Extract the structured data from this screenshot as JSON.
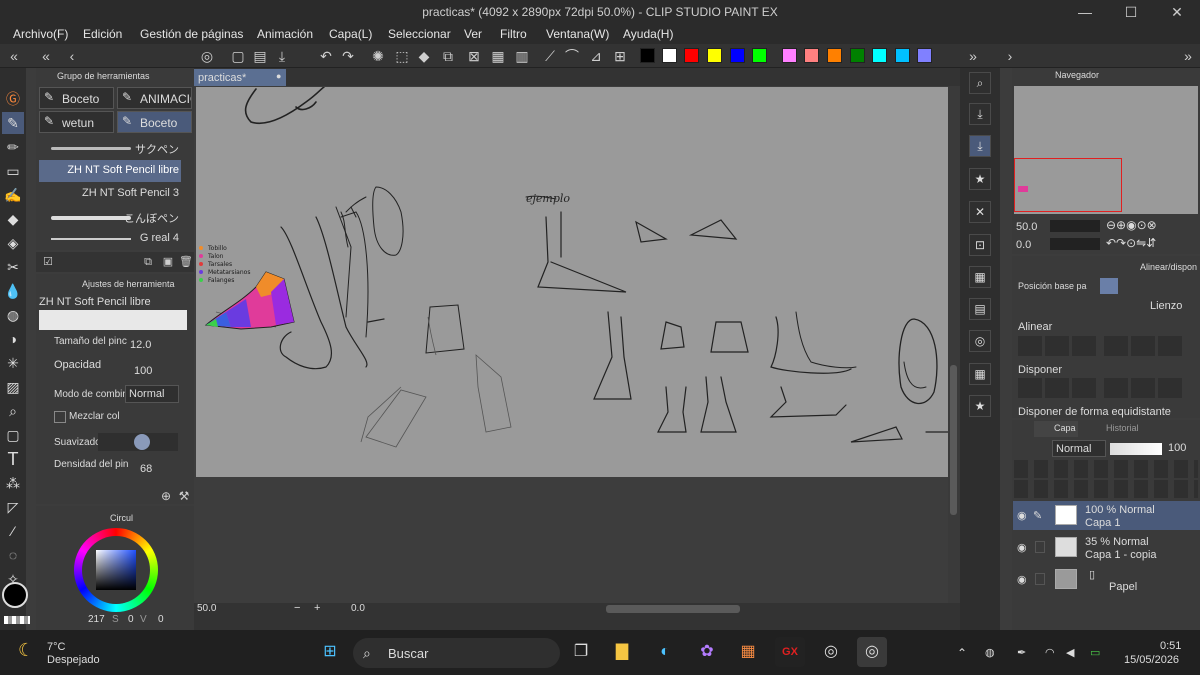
{
  "window": {
    "title": "practicas* (4092 x 2890px 72dpi 50.0%) - CLIP STUDIO PAINT EX",
    "min": "—",
    "max": "☐",
    "close": "✕"
  },
  "menu": [
    "Archivo(F)",
    "Edición",
    "Gestión de páginas",
    "Animación",
    "Capa(L)",
    "Seleccionar",
    "Ver",
    "Filtro",
    "Ventana(W)",
    "Ayuda(H)"
  ],
  "palette": [
    "#000000",
    "#ffffff",
    "#ff0000",
    "#ffff00",
    "#0000ff",
    "#00ff00",
    "#ff80ff",
    "#ff8080",
    "#ff8000",
    "#008000",
    "#00ffff",
    "#00c0ff",
    "#8080ff"
  ],
  "doc_tab": "practicas*",
  "subtool_panel": {
    "title": "Grupo de herramientas",
    "groups": [
      "Boceto",
      "ANIMACIO",
      "wetun",
      "Boceto"
    ],
    "brushes": [
      "サクペン",
      "ZH NT Soft Pencil libre",
      "ZH NT Soft Pencil 3",
      "こんぼペン",
      "G real 4"
    ]
  },
  "tool_property": {
    "title": "Ajustes de herramienta",
    "brush_name": "ZH NT Soft Pencil libre",
    "rows": {
      "size_label": "Tamaño del pinc",
      "size_value": "12.0",
      "opacity_label": "Opacidad",
      "opacity_value": "100",
      "blend_label": "Modo de combina",
      "blend_value": "Normal",
      "mix_label": "Mezclar col",
      "smooth_label": "Suavizado",
      "density_label": "Densidad del pin",
      "density_value": "68"
    }
  },
  "color_panel": {
    "title": "Circul",
    "readout": [
      "217",
      "0",
      "0"
    ],
    "readout_labels": [
      "S",
      "V"
    ]
  },
  "navigator": {
    "title": "Navegador",
    "zoom": "50.0",
    "rotation": "0.0"
  },
  "align_panel": {
    "title": "Alinear/dispon",
    "position_label": "Posición base pa",
    "canvas_label": "Lienzo",
    "align_label": "Alinear",
    "distribute_label": "Disponer",
    "even_label": "Disponer de forma equidistante"
  },
  "layers_panel": {
    "tabs": [
      "Capa",
      "Historial"
    ],
    "blend": "Normal",
    "opacity": "100",
    "layers": [
      {
        "mode": "100 % Normal",
        "name": "Capa 1"
      },
      {
        "mode": "35 % Normal",
        "name": "Capa 1 - copia"
      },
      {
        "mode": "",
        "name": "Papel"
      }
    ]
  },
  "canvas_status": {
    "zoom": "50.0",
    "angle": "0.0"
  },
  "sketch_labels": {
    "legend": [
      "Tobillo",
      "Talon",
      "Tarsales",
      "Metatarsianos",
      "Falanges"
    ],
    "ejemplo": "ejemplo"
  },
  "taskbar": {
    "weather_temp": "7°C",
    "weather_desc": "Despejado",
    "search": "Buscar",
    "time": "0:51",
    "date": "15/05/2026"
  }
}
